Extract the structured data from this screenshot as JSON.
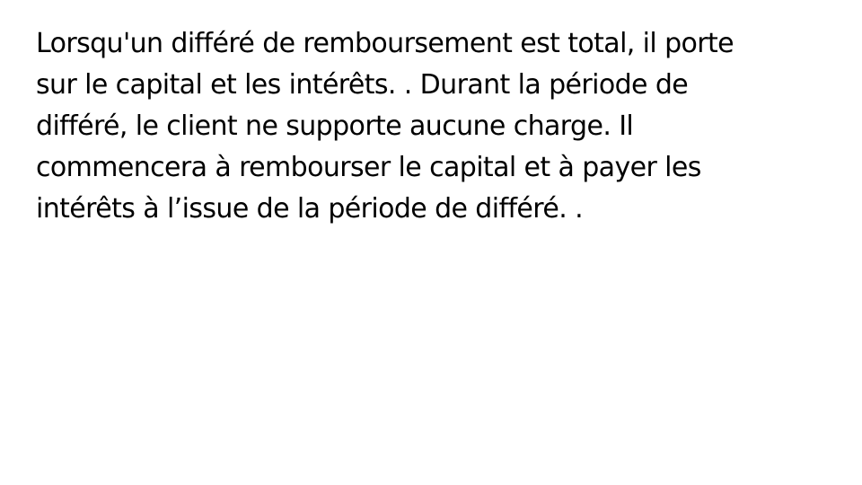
{
  "slide": {
    "text_color": "#000000",
    "background_color": "#ffffff",
    "paragraph_lines": [
      "Lorsqu'un différé de remboursement est total, il porte",
      "sur le capital et les intérêts. . Durant la période de",
      "différé, le client ne supporte aucune charge. Il",
      "commencera à rembourser le capital et à payer les",
      "intérêts à l’issue de la période de différé. ."
    ]
  }
}
